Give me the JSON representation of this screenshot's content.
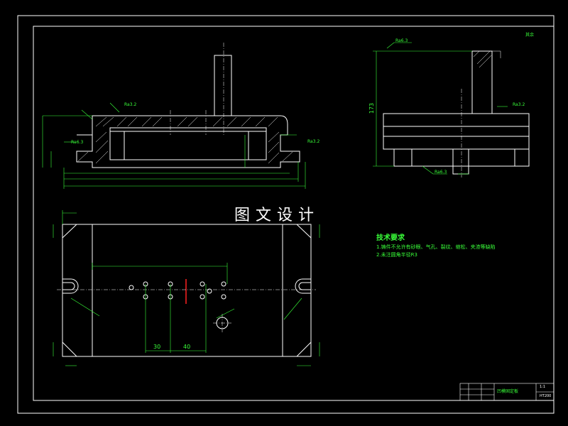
{
  "drawing": {
    "watermark": "图文设计",
    "roughness_top_right": "其余",
    "tech_requirements": {
      "title": "技术要求",
      "items": [
        "1.铸件不允许有砂眼、气孔、裂纹、缩松、夹渣等缺陷",
        "2.未注圆角半径R3"
      ]
    },
    "roughness_labels": [
      "Ra6.3",
      "Ra3.2",
      "Ra3.2",
      "Ra6.3",
      "Ra3.2",
      "Ra6.3"
    ],
    "dimensions": {
      "top_view_height": "173",
      "plan_dim_1": "30",
      "plan_dim_2": "40"
    },
    "title_block": {
      "part_name": "凹模固定板",
      "scale": "1:1",
      "material": "HT200"
    }
  },
  "colors": {
    "background": "#000000",
    "frame": "#ffffff",
    "geometry": "#ffffff",
    "dimension": "#39ff39",
    "centerline": "#ffffff",
    "hatch": "#ffffff",
    "red_mark": "#ff2020"
  }
}
